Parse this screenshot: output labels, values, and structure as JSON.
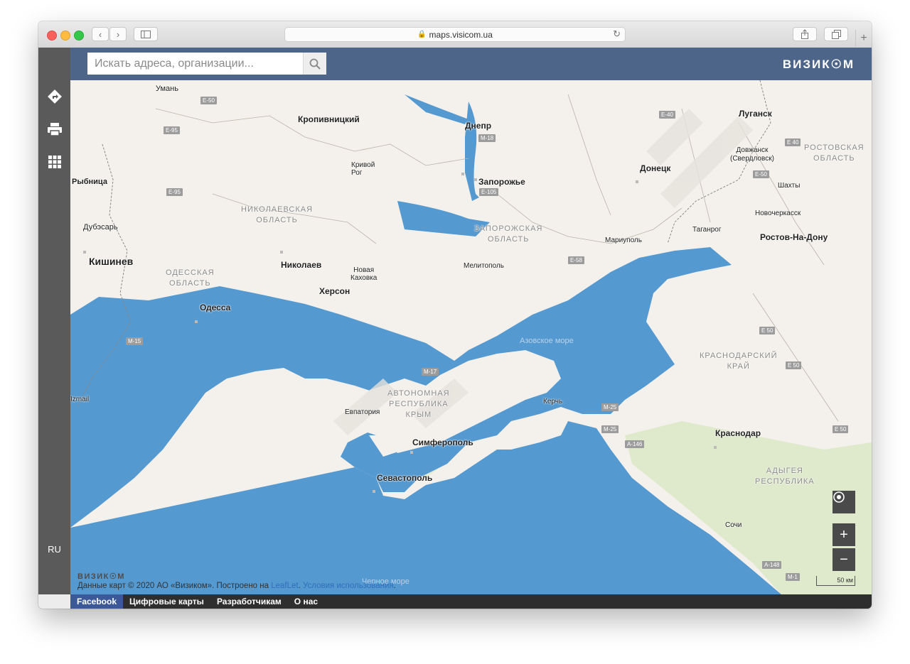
{
  "browser": {
    "url": "maps.visicom.ua",
    "new_tab_label": "+"
  },
  "header": {
    "search_placeholder": "Искать адреса, организации...",
    "logo_text": "ВИЗИК☉М"
  },
  "sidebar": {
    "language": "RU",
    "icons": [
      "route-icon",
      "print-icon",
      "apps-grid-icon"
    ]
  },
  "map": {
    "cities": {
      "uman": "Умань",
      "kropyvnytskyi": "Кропивницкий",
      "dnepr": "Днепр",
      "lugansk": "Луганск",
      "dovzhansk": "Довжанск\n(Свердловск)",
      "krivoy_rog": "Кривой\nРог",
      "zaporozhye": "Запорожье",
      "donetsk": "Донецк",
      "rybnitsa": "Рыбница",
      "shakhty": "Шахты",
      "novocherkassk": "Новочеркасск",
      "dubossary": "Дубэсарь",
      "taganrog": "Таганрог",
      "rostov": "Ростов-На-Дону",
      "mariupol": "Мариуполь",
      "chisinau": "Кишинев",
      "nikolaev": "Николаев",
      "nova_kakhovka": "Новая\nКаховка",
      "melitopol": "Мелитополь",
      "kherson": "Херсон",
      "odessa": "Одесса",
      "izmail": "Izmail",
      "yevpatoria": "Евпатория",
      "kerch": "Керчь",
      "krasnodar": "Краснодар",
      "simferopol": "Симферополь",
      "sevastopol": "Севастополь",
      "sochi": "Сочи"
    },
    "regions": {
      "nikolaev_oblast": "НИКОЛАЕВСКАЯ\nОБЛАСТЬ",
      "zaporozhye_oblast": "ЗАПОРОЖСКАЯ\nОБЛАСТЬ",
      "odessa_oblast": "ОДЕССКАЯ\nОБЛАСТЬ",
      "rostov_oblast": "РОСТОВСКАЯ\nОБЛАСТЬ",
      "krasnodar_krai": "КРАСНОДАРСКИЙ\nКРАЙ",
      "crimea": "АВТОНОМНАЯ\nРЕСПУБЛИКА\nКРЫМ",
      "adygea": "АДЫГЕЯ\nРЕСПУБЛИКА"
    },
    "seas": {
      "azov": "Азовское море",
      "black": "Черное море"
    },
    "roads": [
      "E-50",
      "E-95",
      "M-18",
      "E-40",
      "E-105",
      "E-58",
      "M-15",
      "M-17",
      "M-25",
      "A-146",
      "E 50",
      "E 40",
      "M-1",
      "A-148"
    ],
    "scale_label": "50 км",
    "zoom_in": "+",
    "zoom_out": "−",
    "attribution": {
      "logo": "ВИЗИК☉М",
      "text": "Данные карт © 2020 АО «Визиком». Построено на ",
      "leaflet": "LeafLet",
      "terms": "Условия использования"
    },
    "colors": {
      "water": "#5499d0",
      "land": "#f2efe9",
      "forest": "#dce8c8",
      "header": "#4d6588"
    }
  },
  "footer": {
    "links": [
      "Facebook",
      "Цифровые карты",
      "Разработчикам",
      "О нас"
    ]
  }
}
